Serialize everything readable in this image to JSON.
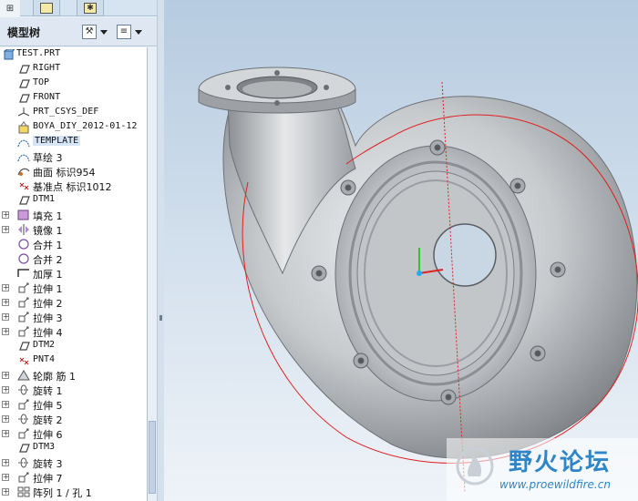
{
  "panel": {
    "title": "模型树",
    "tabs": [
      {
        "name": "model-tree-tab"
      },
      {
        "name": "folder-browser-tab"
      },
      {
        "name": "favorites-tab"
      }
    ]
  },
  "tree": {
    "root": "TEST.PRT",
    "items": [
      {
        "label": "RIGHT",
        "icon": "datum-plane-icon",
        "expandable": false
      },
      {
        "label": "TOP",
        "icon": "datum-plane-icon",
        "expandable": false
      },
      {
        "label": "FRONT",
        "icon": "datum-plane-icon",
        "expandable": false
      },
      {
        "label": "PRT_CSYS_DEF",
        "icon": "csys-icon",
        "expandable": false
      },
      {
        "label": "BOYA_DIY_2012-01-12",
        "icon": "udf-icon",
        "expandable": false
      },
      {
        "label": "TEMPLATE",
        "icon": "sketch-icon",
        "expandable": false,
        "highlighted": true
      },
      {
        "label": "草绘 3",
        "icon": "sketch-icon",
        "expandable": false
      },
      {
        "label": "曲面 标识954",
        "icon": "surface-icon",
        "expandable": false
      },
      {
        "label": "基准点 标识1012",
        "icon": "datum-point-icon",
        "expandable": false
      },
      {
        "label": "DTM1",
        "icon": "datum-plane-icon",
        "expandable": false
      },
      {
        "label": "填充 1",
        "icon": "fill-icon",
        "expandable": true
      },
      {
        "label": "镜像 1",
        "icon": "mirror-icon",
        "expandable": true
      },
      {
        "label": "合并 1",
        "icon": "merge-icon",
        "expandable": false
      },
      {
        "label": "合并 2",
        "icon": "merge-icon",
        "expandable": false
      },
      {
        "label": "加厚 1",
        "icon": "thicken-icon",
        "expandable": false
      },
      {
        "label": "拉伸 1",
        "icon": "extrude-icon",
        "expandable": true
      },
      {
        "label": "拉伸 2",
        "icon": "extrude-icon",
        "expandable": true
      },
      {
        "label": "拉伸 3",
        "icon": "extrude-icon",
        "expandable": true
      },
      {
        "label": "拉伸 4",
        "icon": "extrude-icon",
        "expandable": true
      },
      {
        "label": "DTM2",
        "icon": "datum-plane-icon",
        "expandable": false
      },
      {
        "label": "PNT4",
        "icon": "datum-point-icon",
        "expandable": false
      },
      {
        "label": "轮廓 筋 1",
        "icon": "rib-icon",
        "expandable": true
      },
      {
        "label": "旋转 1",
        "icon": "revolve-icon",
        "expandable": true
      },
      {
        "label": "拉伸 5",
        "icon": "extrude-icon",
        "expandable": true
      },
      {
        "label": "旋转 2",
        "icon": "revolve-icon",
        "expandable": true
      },
      {
        "label": "拉伸 6",
        "icon": "extrude-icon",
        "expandable": true
      },
      {
        "label": "DTM3",
        "icon": "datum-plane-icon",
        "expandable": false
      },
      {
        "label": "旋转 3",
        "icon": "revolve-icon",
        "expandable": true
      },
      {
        "label": "拉伸 7",
        "icon": "extrude-icon",
        "expandable": true
      },
      {
        "label": "阵列 1 / 孔 1",
        "icon": "pattern-icon",
        "expandable": true
      }
    ]
  },
  "watermark": {
    "name": "野火论坛",
    "url": "www.proewildfire.cn"
  },
  "colors": {
    "model_gray": "#b9bcc0",
    "sketch_red": "#e02020",
    "tree_bg": "#ffffff",
    "watermark_blue": "#2e86c9"
  }
}
